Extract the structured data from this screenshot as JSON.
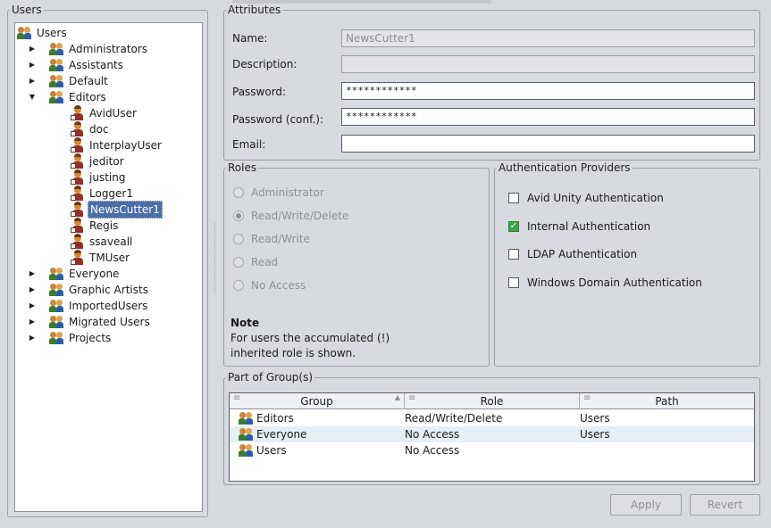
{
  "left_panel": {
    "legend": "Users",
    "tree": [
      {
        "label": "Users",
        "icon": "group-icon",
        "level": 0,
        "expand": "none"
      },
      {
        "label": "Administrators",
        "icon": "group-icon",
        "level": 1,
        "expand": "collapsed"
      },
      {
        "label": "Assistants",
        "icon": "group-icon",
        "level": 1,
        "expand": "collapsed"
      },
      {
        "label": "Default",
        "icon": "group-icon",
        "level": 1,
        "expand": "collapsed"
      },
      {
        "label": "Editors",
        "icon": "group-icon",
        "level": 1,
        "expand": "expanded"
      },
      {
        "label": "AvidUser",
        "icon": "user-icon",
        "level": 2,
        "expand": "none"
      },
      {
        "label": "doc",
        "icon": "user-icon",
        "level": 2,
        "expand": "none"
      },
      {
        "label": "InterplayUser",
        "icon": "user-icon",
        "level": 2,
        "expand": "none"
      },
      {
        "label": "jeditor",
        "icon": "user-icon",
        "level": 2,
        "expand": "none"
      },
      {
        "label": "justing",
        "icon": "user-icon",
        "level": 2,
        "expand": "none"
      },
      {
        "label": "Logger1",
        "icon": "user-icon",
        "level": 2,
        "expand": "none"
      },
      {
        "label": "NewsCutter1",
        "icon": "user-icon",
        "level": 2,
        "expand": "none",
        "selected": true
      },
      {
        "label": "Regis",
        "icon": "user-icon",
        "level": 2,
        "expand": "none"
      },
      {
        "label": "ssaveall",
        "icon": "user-icon",
        "level": 2,
        "expand": "none"
      },
      {
        "label": "TMUser",
        "icon": "user-icon",
        "level": 2,
        "expand": "none"
      },
      {
        "label": "Everyone",
        "icon": "group-icon",
        "level": 1,
        "expand": "collapsed"
      },
      {
        "label": "Graphic Artists",
        "icon": "group-icon",
        "level": 1,
        "expand": "collapsed"
      },
      {
        "label": "ImportedUsers",
        "icon": "group-icon",
        "level": 1,
        "expand": "collapsed"
      },
      {
        "label": "Migrated Users",
        "icon": "group-icon",
        "level": 1,
        "expand": "collapsed"
      },
      {
        "label": "Projects",
        "icon": "group-icon",
        "level": 1,
        "expand": "collapsed"
      }
    ]
  },
  "attributes": {
    "legend": "Attributes",
    "name_label": "Name:",
    "name_value": "NewsCutter1",
    "description_label": "Description:",
    "description_value": "",
    "password_label": "Password:",
    "password_value": "************",
    "password_conf_label": "Password (conf.):",
    "password_conf_value": "************",
    "email_label": "Email:",
    "email_value": ""
  },
  "roles": {
    "legend": "Roles",
    "options": [
      {
        "label": "Administrator",
        "checked": false
      },
      {
        "label": "Read/Write/Delete",
        "checked": true
      },
      {
        "label": "Read/Write",
        "checked": false
      },
      {
        "label": "Read",
        "checked": false
      },
      {
        "label": "No Access",
        "checked": false
      }
    ],
    "note_title": "Note",
    "note_line1": "For users the accumulated (!)",
    "note_line2": "inherited role is shown."
  },
  "auth": {
    "legend": "Authentication Providers",
    "options": [
      {
        "label": "Avid Unity Authentication",
        "checked": false
      },
      {
        "label": "Internal Authentication",
        "checked": true
      },
      {
        "label": "LDAP Authentication",
        "checked": false
      },
      {
        "label": "Windows Domain Authentication",
        "checked": false
      }
    ]
  },
  "groups": {
    "legend": "Part of Group(s)",
    "columns": [
      "Group",
      "Role",
      "Path"
    ],
    "rows": [
      {
        "group": "Editors",
        "role": "Read/Write/Delete",
        "path": "Users"
      },
      {
        "group": "Everyone",
        "role": "No Access",
        "path": "Users"
      },
      {
        "group": "Users",
        "role": "No Access",
        "path": ""
      }
    ]
  },
  "buttons": {
    "apply": "Apply",
    "revert": "Revert"
  },
  "colors": {
    "background": "#d7dadf",
    "selection": "#4a6fa5",
    "check_green": "#3aa648",
    "alt_row": "#e6eef6"
  }
}
